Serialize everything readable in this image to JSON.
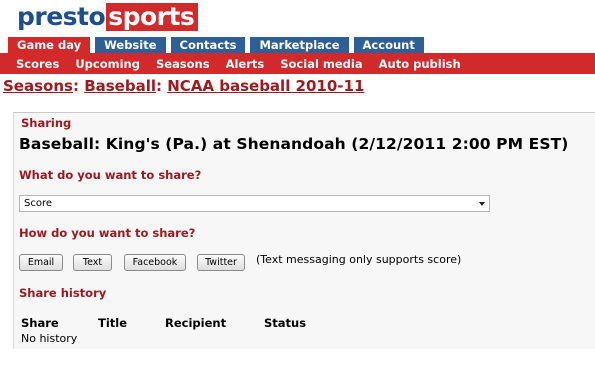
{
  "logo": {
    "part1": "presto",
    "part2": "sports"
  },
  "top_tabs": [
    {
      "label": "Game day",
      "active": true
    },
    {
      "label": "Website",
      "active": false
    },
    {
      "label": "Contacts",
      "active": false
    },
    {
      "label": "Marketplace",
      "active": false
    },
    {
      "label": "Account",
      "active": false
    }
  ],
  "sub_nav": [
    "Scores",
    "Upcoming",
    "Seasons",
    "Alerts",
    "Social media",
    "Auto publish"
  ],
  "breadcrumb": {
    "seasons": "Seasons",
    "sep1": ": ",
    "sport": "Baseball",
    "sep2": ": ",
    "season": "NCAA baseball 2010-11"
  },
  "panel": {
    "heading": "Sharing",
    "game_title": "Baseball: King's (Pa.) at Shenandoah (2/12/2011 2:00 PM EST)",
    "what_label": "What do you want to share?",
    "what_selected": "Score",
    "how_label": "How do you want to share?",
    "buttons": {
      "email": "Email",
      "text": "Text",
      "facebook": "Facebook",
      "twitter": "Twitter"
    },
    "note": "(Text messaging only supports score)",
    "history_heading": "Share history",
    "history_columns": {
      "share": "Share",
      "title": "Title",
      "recipient": "Recipient",
      "status": "Status"
    },
    "history_empty": "No history"
  },
  "colors": {
    "brand_red": "#d22a2a",
    "brand_blue": "#2e5f98",
    "link_red": "#a0191f"
  }
}
